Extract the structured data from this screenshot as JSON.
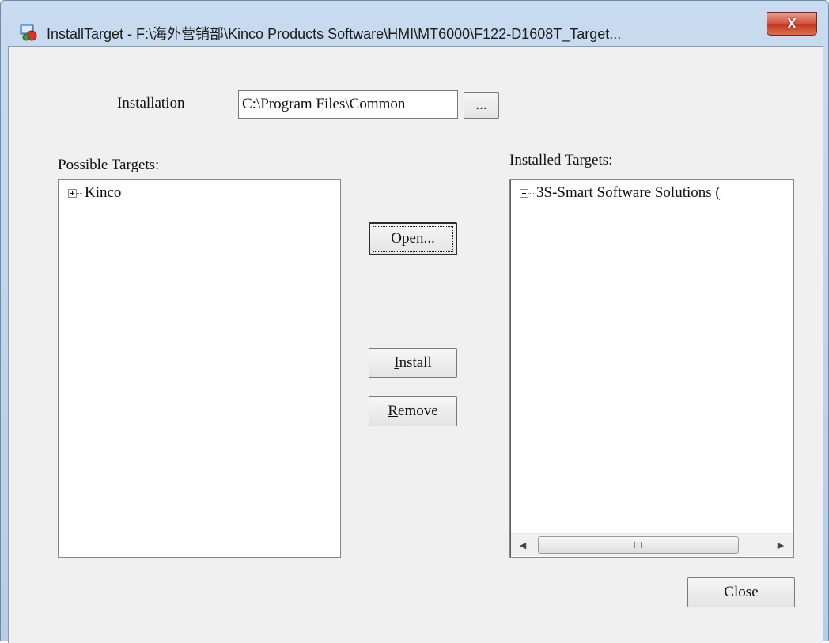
{
  "window": {
    "title": "InstallTarget - F:\\海外营销部\\Kinco Products Software\\HMI\\MT6000\\F122-D1608T_Target...",
    "close_glyph": "X",
    "app_icon": "install-target-app-icon"
  },
  "installation": {
    "label": "Installation",
    "path_value": "C:\\Program Files\\Common",
    "browse_label": "..."
  },
  "possible_targets": {
    "label": "Possible Targets:",
    "items": [
      {
        "label": "Kinco",
        "expand_icon": "plus-box-icon"
      }
    ]
  },
  "installed_targets": {
    "label": "Installed Targets:",
    "items": [
      {
        "label": "3S-Smart Software Solutions (",
        "expand_icon": "plus-box-icon"
      }
    ],
    "scrollbar": {
      "left_arrow": "◀",
      "right_arrow": "▶",
      "grip": "III"
    }
  },
  "buttons": {
    "open": "Open...",
    "install": "Install",
    "remove": "Remove",
    "close": "Close"
  },
  "colors": {
    "close_button": "#d2503a",
    "titlebar": "#c9dbef",
    "dialog_background": "#f0f0f0"
  }
}
